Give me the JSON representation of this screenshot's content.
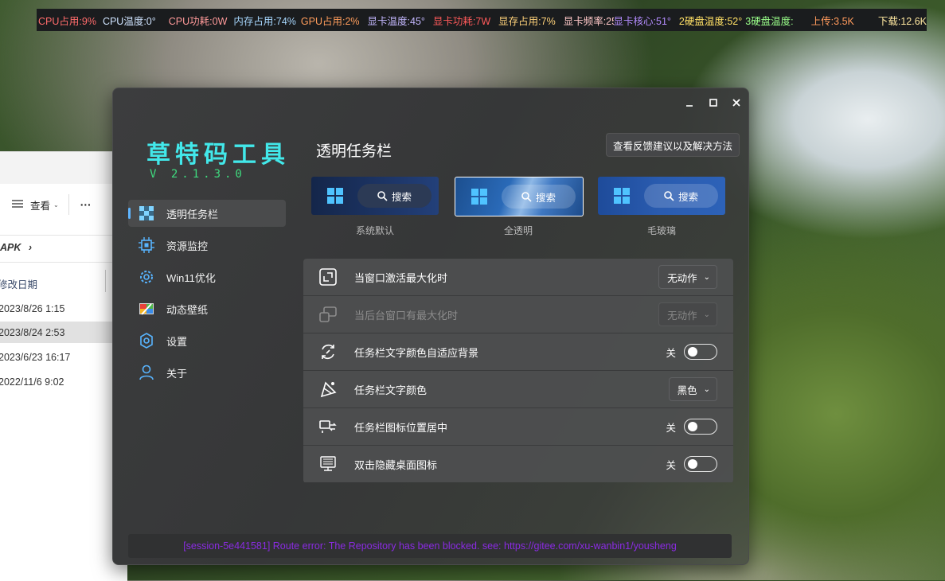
{
  "monitor": [
    {
      "text": "CPU占用:9%",
      "color": "#ff6b6b"
    },
    {
      "text": "CPU温度:0°",
      "color": "#d0e4ff"
    },
    {
      "text": "CPU功耗:0W",
      "color": "#ff9a9a"
    },
    {
      "text": "内存占用:74%",
      "color": "#a8d8ff"
    },
    {
      "text": "GPU占用:2%",
      "color": "#ff9d5c"
    },
    {
      "text": "显卡温度:45°",
      "color": "#c4b8ff"
    },
    {
      "text": "显卡功耗:7W",
      "color": "#ff5a5a"
    },
    {
      "text": "显存占用:7%",
      "color": "#ffd27a"
    },
    {
      "text": "显卡频率:253M",
      "color": "#ffc8c8"
    },
    {
      "text": "显卡核心:51°",
      "color": "#b48cff"
    },
    {
      "text": "2硬盘温度:52°",
      "color": "#ffe066"
    },
    {
      "text": "3硬盘温度:",
      "color": "#9aff8a"
    },
    {
      "text": "上传:3.5K",
      "color": "#ff9a5c"
    },
    {
      "text": "下载:12.6K",
      "color": "#ffe8a0"
    }
  ],
  "explorer": {
    "view_label": "查看",
    "more_label": "···",
    "path_label": "APK",
    "col_header": "修改日期",
    "rows": [
      "2023/8/26 1:15",
      "2023/8/24 2:53",
      "2023/6/23 16:17",
      "2022/11/6 9:02"
    ]
  },
  "app": {
    "title": "草特码工具",
    "version": "V 2.1.3.0",
    "nav": [
      {
        "label": "透明任务栏",
        "icon": "checker-icon",
        "active": true
      },
      {
        "label": "资源监控",
        "icon": "chip-icon"
      },
      {
        "label": "Win11优化",
        "icon": "gear-icon"
      },
      {
        "label": "动态壁纸",
        "icon": "wallpaper-icon"
      },
      {
        "label": "设置",
        "icon": "settings-icon"
      },
      {
        "label": "关于",
        "icon": "user-icon"
      }
    ],
    "page_title": "透明任务栏",
    "feedback_button": "查看反馈建议以及解决方法",
    "previews": [
      {
        "label": "系统默认",
        "search": "搜索",
        "selected": false
      },
      {
        "label": "全透明",
        "search": "搜索",
        "selected": true
      },
      {
        "label": "毛玻璃",
        "search": "搜索",
        "selected": false
      }
    ],
    "settings": [
      {
        "label": "当窗口激活最大化时",
        "icon": "maximize-icon",
        "control": "dropdown",
        "value": "无动作",
        "disabled": false
      },
      {
        "label": "当后台窗口有最大化时",
        "icon": "windows-stack-icon",
        "control": "dropdown",
        "value": "无动作",
        "disabled": true
      },
      {
        "label": "任务栏文字颜色自适应背景",
        "icon": "refresh-color-icon",
        "control": "toggle",
        "value": "关"
      },
      {
        "label": "任务栏文字颜色",
        "icon": "paint-icon",
        "control": "dropdown",
        "value": "黑色",
        "disabled": false
      },
      {
        "label": "任务栏图标位置居中",
        "icon": "center-icon",
        "control": "toggle",
        "value": "关"
      },
      {
        "label": "双击隐藏桌面图标",
        "icon": "desktop-icon",
        "control": "toggle",
        "value": "关"
      }
    ],
    "status_message": "[session-5e441581] Route error: The Repository has been blocked. see: https://gitee.com/xu-wanbin1/yousheng"
  },
  "colors": {
    "accent_cyan": "#42e8ea",
    "version_green": "#3fdc7f",
    "status_purple": "#8a2be2",
    "nav_indicator": "#5fb5ff"
  }
}
